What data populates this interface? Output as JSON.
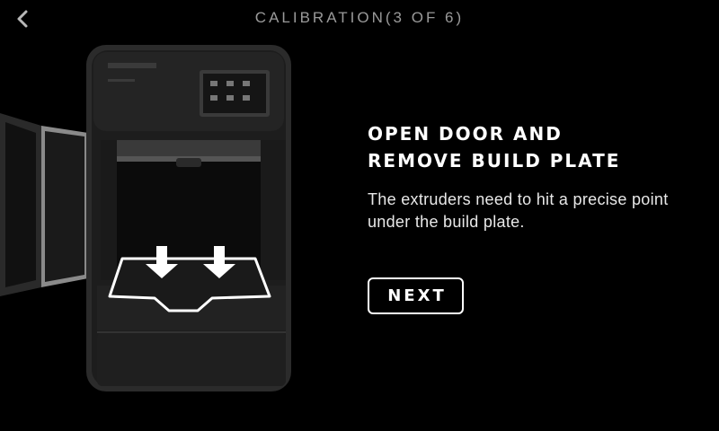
{
  "header": {
    "title": "CALIBRATION(3 OF 6)",
    "back_icon": "chevron-left-icon"
  },
  "illustration": {
    "subject": "3d-printer-open-door",
    "arrow_icon": "arrow-down-icon"
  },
  "content": {
    "heading_line1": "OPEN DOOR AND",
    "heading_line2": "REMOVE BUILD PLATE",
    "description": "The extruders need to hit a precise point under the build plate.",
    "next_label": "NEXT"
  },
  "colors": {
    "background": "#000000",
    "title": "#9a9a9a",
    "text": "#ffffff"
  }
}
